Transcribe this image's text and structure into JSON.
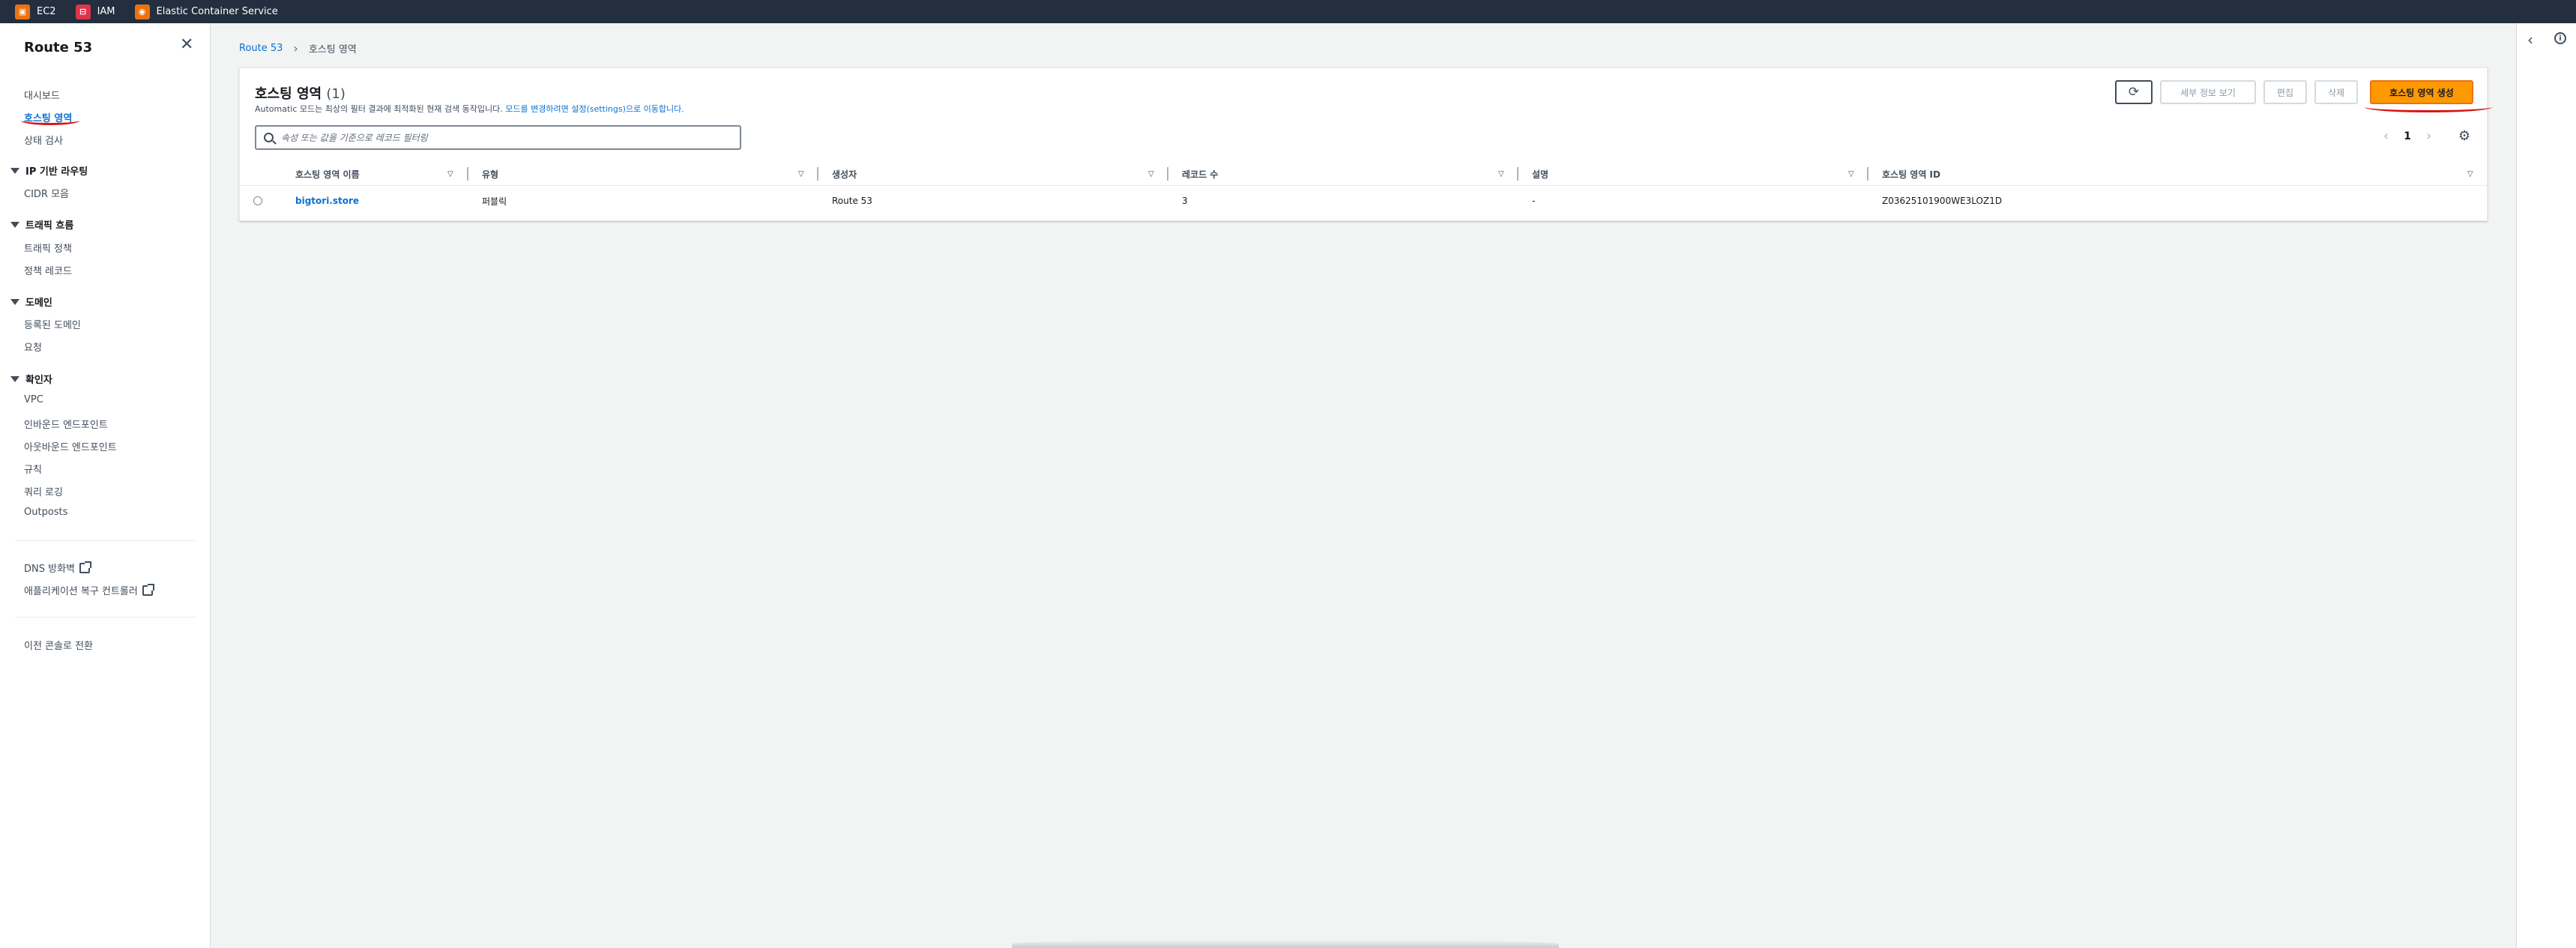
{
  "topbar": {
    "services": [
      {
        "label": "EC2",
        "icon": "ec2-icon",
        "color": "#ec7211"
      },
      {
        "label": "IAM",
        "icon": "iam-icon",
        "color": "#dd344c"
      },
      {
        "label": "Elastic Container Service",
        "icon": "ecs-icon",
        "color": "#ec7211"
      }
    ]
  },
  "sidebar": {
    "title": "Route 53",
    "links": {
      "dashboard": "대시보드",
      "hosted_zones": "호스팅 영역",
      "health_checks": "상태 검사"
    },
    "groups": {
      "ip_routing": {
        "title": "IP 기반 라우팅",
        "items": [
          "CIDR 모음"
        ]
      },
      "traffic_flow": {
        "title": "트래픽 흐름",
        "items": [
          "트래픽 정책",
          "정책 레코드"
        ]
      },
      "domains": {
        "title": "도메인",
        "items": [
          "등록된 도메인",
          "요청"
        ]
      },
      "resolver": {
        "title": "확인자",
        "items": [
          "VPC",
          "인바운드 엔드포인트",
          "아웃바운드 엔드포인트",
          "규칙",
          "쿼리 로깅",
          "Outposts"
        ]
      }
    },
    "external": [
      "DNS 방화벽",
      "애플리케이션 복구 컨트롤러"
    ],
    "legacy": "이전 콘솔로 전환"
  },
  "breadcrumb": {
    "root": "Route 53",
    "current": "호스팅 영역"
  },
  "panel": {
    "title": "호스팅 영역",
    "count": "(1)",
    "desc_prefix": "Automatic 모드는 최상의 필터 결과에 최적화된 현재 검색 동작입니다.",
    "desc_link": "모드를 변경하려면 설정(settings)으로 이동합니다.",
    "buttons": {
      "details": "세부 정보 보기",
      "edit": "편집",
      "delete": "삭제",
      "create": "호스팅 영역 생성"
    },
    "search_placeholder": "속성 또는 값을 기준으로 레코드 필터링",
    "page": "1"
  },
  "table": {
    "columns": [
      "호스팅 영역 이름",
      "유형",
      "생성자",
      "레코드 수",
      "설명",
      "호스팅 영역 ID"
    ],
    "rows": [
      {
        "name": "bigtori.store",
        "type": "퍼블릭",
        "creator": "Route 53",
        "records": "3",
        "desc": "-",
        "id": "Z03625101900WE3LOZ1D"
      }
    ]
  }
}
